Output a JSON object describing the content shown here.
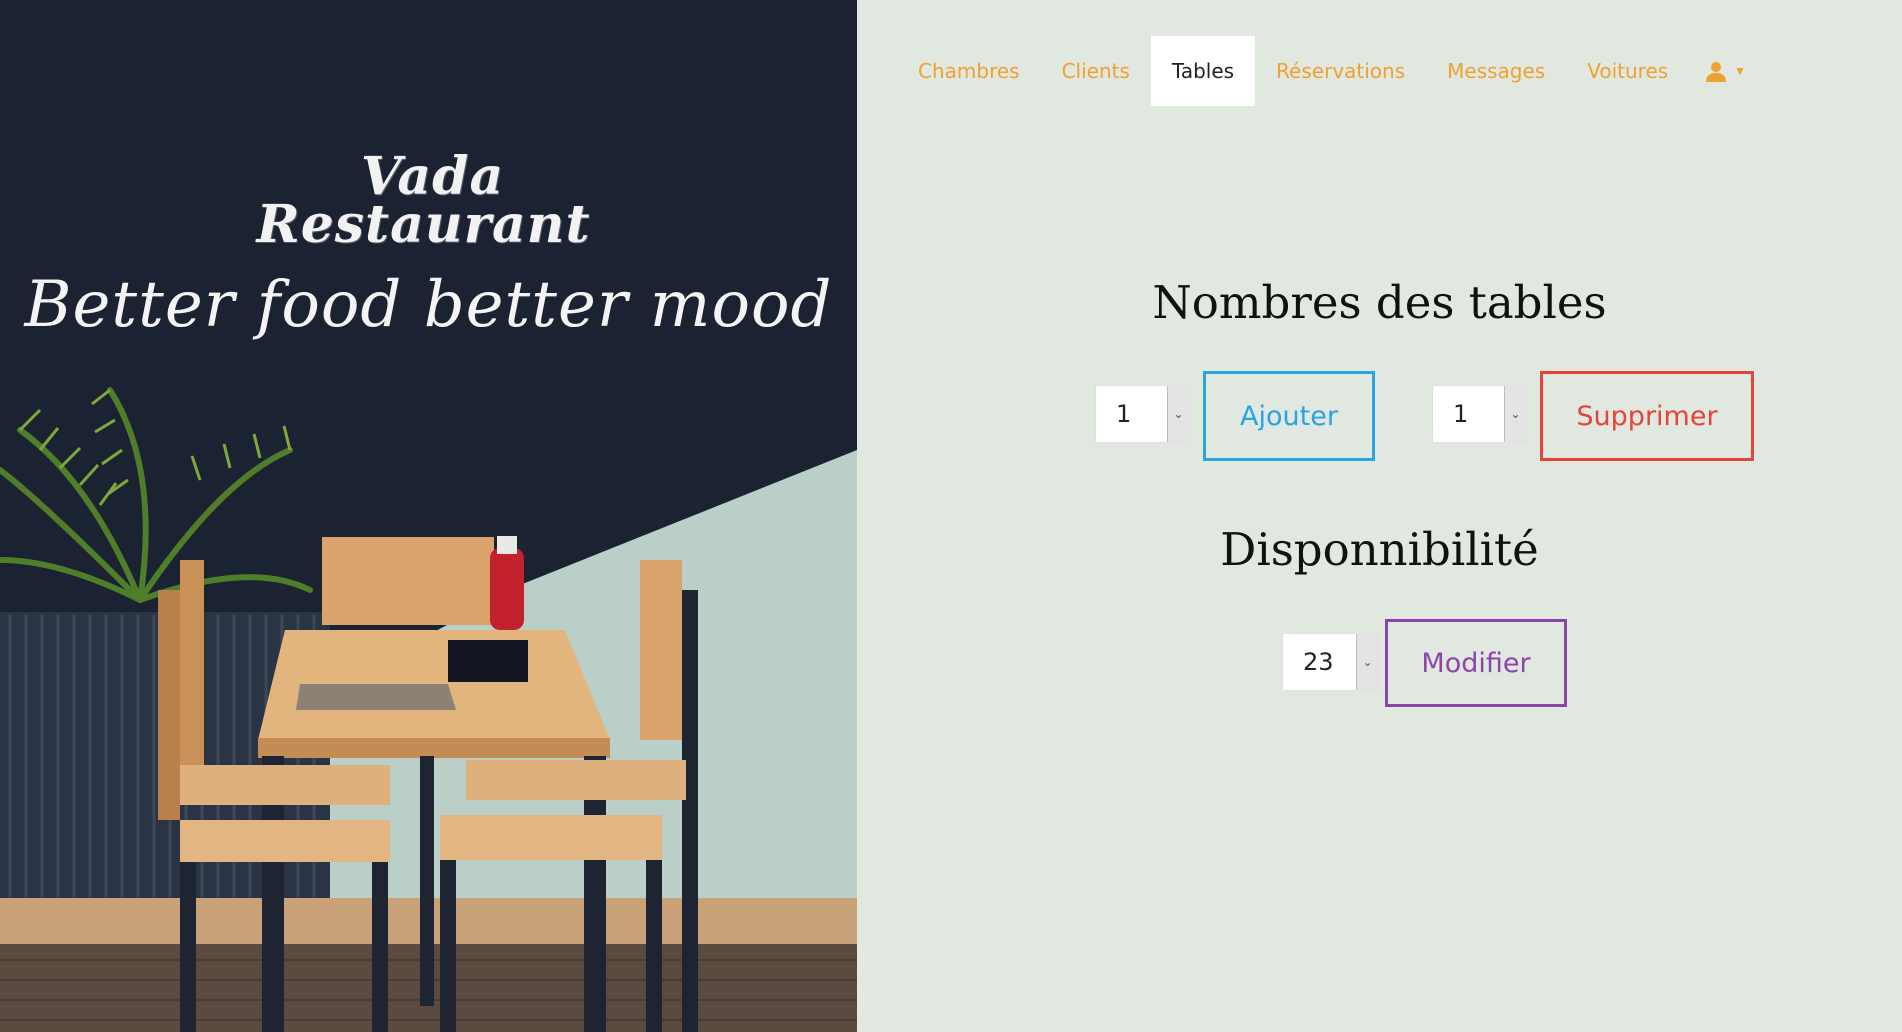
{
  "hero": {
    "brand_line1": "Vada",
    "brand_line2": "Restaurant",
    "tagline": "Better food better mood"
  },
  "nav": {
    "items": [
      {
        "label": "Chambres",
        "active": false
      },
      {
        "label": "Clients",
        "active": false
      },
      {
        "label": "Tables",
        "active": true
      },
      {
        "label": "Réservations",
        "active": false
      },
      {
        "label": "Messages",
        "active": false
      },
      {
        "label": "Voitures",
        "active": false
      }
    ],
    "user_icon": "user-icon",
    "caret_icon": "caret-down-icon"
  },
  "tables_section": {
    "title": "Nombres des tables",
    "add_select_value": "1",
    "add_button": "Ajouter",
    "remove_select_value": "1",
    "remove_button": "Supprimer"
  },
  "availability_section": {
    "title": "Disponnibilité",
    "select_value": "23",
    "modify_button": "Modifier"
  },
  "colors": {
    "nav_link": "#efa030",
    "add": "#29a3e3",
    "remove": "#e4453a",
    "modify": "#8e44ad",
    "background": "#e1e8e0"
  }
}
